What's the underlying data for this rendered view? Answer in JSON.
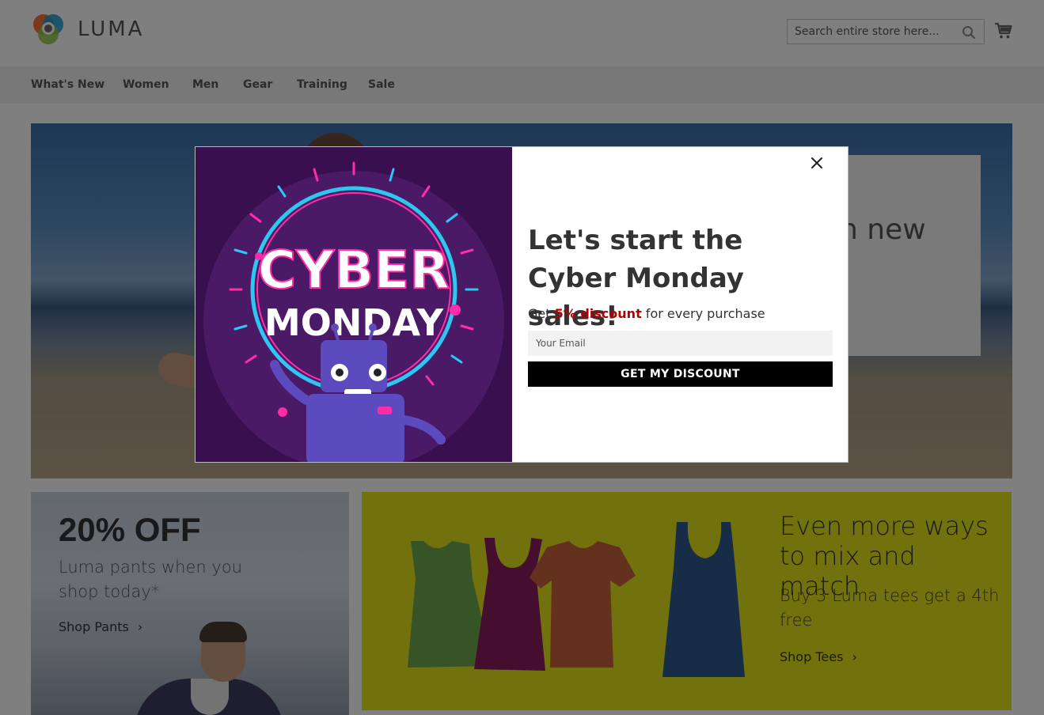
{
  "header": {
    "logo_text": "LUMA",
    "search_placeholder": "Search entire store here...",
    "search_icon": "search-icon",
    "cart_icon": "cart-icon"
  },
  "nav": {
    "items": [
      {
        "label": "What's New"
      },
      {
        "label": "Women"
      },
      {
        "label": "Men"
      },
      {
        "label": "Gear"
      },
      {
        "label": "Training"
      },
      {
        "label": "Sale"
      }
    ]
  },
  "hero": {
    "partial_text": "n new"
  },
  "promo_pants": {
    "heading": "20% OFF",
    "subtext": "Luma pants when you shop today*",
    "link": "Shop Pants"
  },
  "promo_tees": {
    "heading": "Even more ways to mix and match",
    "subtext": "Buy 3 Luma tees get a 4th free",
    "link": "Shop Tees"
  },
  "modal": {
    "image_text_line1": "CYBER",
    "image_text_line2": "MONDAY",
    "title": "Let's start the Cyber Monday sales!",
    "desc_prefix": "Get ",
    "desc_accent": "5% discount",
    "desc_suffix": " for every purchase",
    "email_placeholder": "Your Email",
    "cta_label": "GET MY DISCOUNT",
    "close_icon": "close-icon"
  },
  "colors": {
    "accent_red": "#b30000",
    "tees_bg": "#e2e21c",
    "modal_image_bg": "#3a0f4f"
  }
}
